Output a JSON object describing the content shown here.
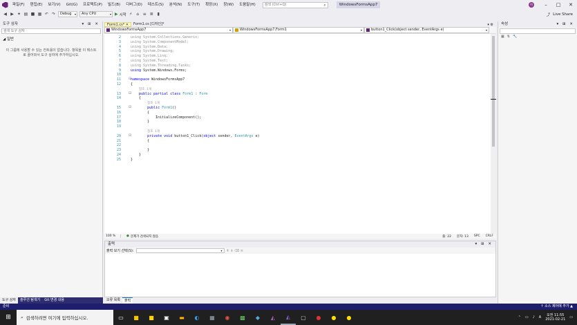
{
  "menu": [
    "파일(F)",
    "편집(E)",
    "보기(V)",
    "Git(G)",
    "프로젝트(P)",
    "빌드(B)",
    "디버그(D)",
    "테스트(S)",
    "분석(N)",
    "도구(T)",
    "확장(X)",
    "창(W)",
    "도움말(H)"
  ],
  "search_placeholder": "검색 (Ctrl+Q)",
  "app_title": "WindowsFormsApp7",
  "user_initials": "이",
  "toolbar": {
    "config": "Debug",
    "platform": "Any CPU",
    "start": "시작",
    "live_share": "Live Share"
  },
  "toolbox": {
    "title": "도구 상자",
    "search_placeholder": "검색 도구 상자",
    "section": "◢ 일반",
    "message": "이 그룹에 사용할 수 있는 컨트롤이 없습니다. 항목을 이 텍스트로 끌어와서 도구 상자에 추가하십시오."
  },
  "left_tabs": [
    "도구 상자",
    "솔루션 탐색기",
    "Git 변경 내용"
  ],
  "doc_tabs": [
    "Form1.cs*",
    "Form1.cs [디자인]*"
  ],
  "nav": {
    "project": "WindowsFormsApp7",
    "class": "WindowsFormsApp7.Form1",
    "member": "button1_Click(object sender, EventArgs e)"
  },
  "code_lines": [
    {
      "n": "2",
      "html": "<span class='dim'>using System.Collections.Generic;</span>"
    },
    {
      "n": "3",
      "html": "<span class='dim'>using System.ComponentModel;</span>"
    },
    {
      "n": "4",
      "html": "<span class='dim'>using System.Data;</span>"
    },
    {
      "n": "5",
      "html": "<span class='dim'>using System.Drawing;</span>"
    },
    {
      "n": "6",
      "html": "<span class='dim'>using System.Linq;</span>"
    },
    {
      "n": "7",
      "html": "<span class='dim'>using System.Text;</span>"
    },
    {
      "n": "8",
      "html": "<span class='dim'>using System.Threading.Tasks;</span>"
    },
    {
      "n": "9",
      "html": "<span class='kw'>using</span> System.Windows.Forms;"
    },
    {
      "n": "10",
      "html": ""
    },
    {
      "n": "11",
      "html": "<span class='kw'>namespace</span> WindowsFormsApp7"
    },
    {
      "n": "12",
      "html": "{"
    },
    {
      "n": "",
      "html": "    <span class='ref'>참조 1개</span>"
    },
    {
      "n": "13",
      "html": "    <span class='kw'>public partial class</span> <span class='ty'>Form1</span> : <span class='ty'>Form</span>"
    },
    {
      "n": "14",
      "html": "    {"
    },
    {
      "n": "",
      "html": "        <span class='ref'>참조 1개</span>"
    },
    {
      "n": "15",
      "html": "        <span class='kw'>public</span> <span class='ty'>Form1</span>()"
    },
    {
      "n": "16",
      "html": "        {"
    },
    {
      "n": "17",
      "html": "            InitializeComponent();"
    },
    {
      "n": "18",
      "html": "        }"
    },
    {
      "n": "19",
      "html": ""
    },
    {
      "n": "",
      "html": "        <span class='ref'>참조 1개</span>"
    },
    {
      "n": "20",
      "html": "        <span class='kw'>private void</span> button1_Click(<span class='kw'>object</span> sender, <span class='ty'>EventArgs</span> e)"
    },
    {
      "n": "21",
      "html": "        {"
    },
    {
      "n": "22",
      "html": ""
    },
    {
      "n": "23",
      "html": "        }"
    },
    {
      "n": "24",
      "html": "    }"
    },
    {
      "n": "25",
      "html": "}"
    }
  ],
  "editor_status": {
    "zoom": "100 %",
    "issues": "문제가 검색되지 않음",
    "line": "줄: 22",
    "col": "문자: 13",
    "spacing": "SPC",
    "eol": "CRLF"
  },
  "output": {
    "title": "출력",
    "source_label": "출력 보기 선택(S):"
  },
  "bottom_tabs": [
    "오류 목록",
    "출력"
  ],
  "properties_title": "속성",
  "vs_status": {
    "left": "준비",
    "right": "↑ 소스 제어에 추가 ▲"
  },
  "taskbar": {
    "search_placeholder": "검색하려면 여기에 입력하십시오.",
    "ime": "A",
    "time": "오전 11:55",
    "date": "2021-02-21"
  }
}
